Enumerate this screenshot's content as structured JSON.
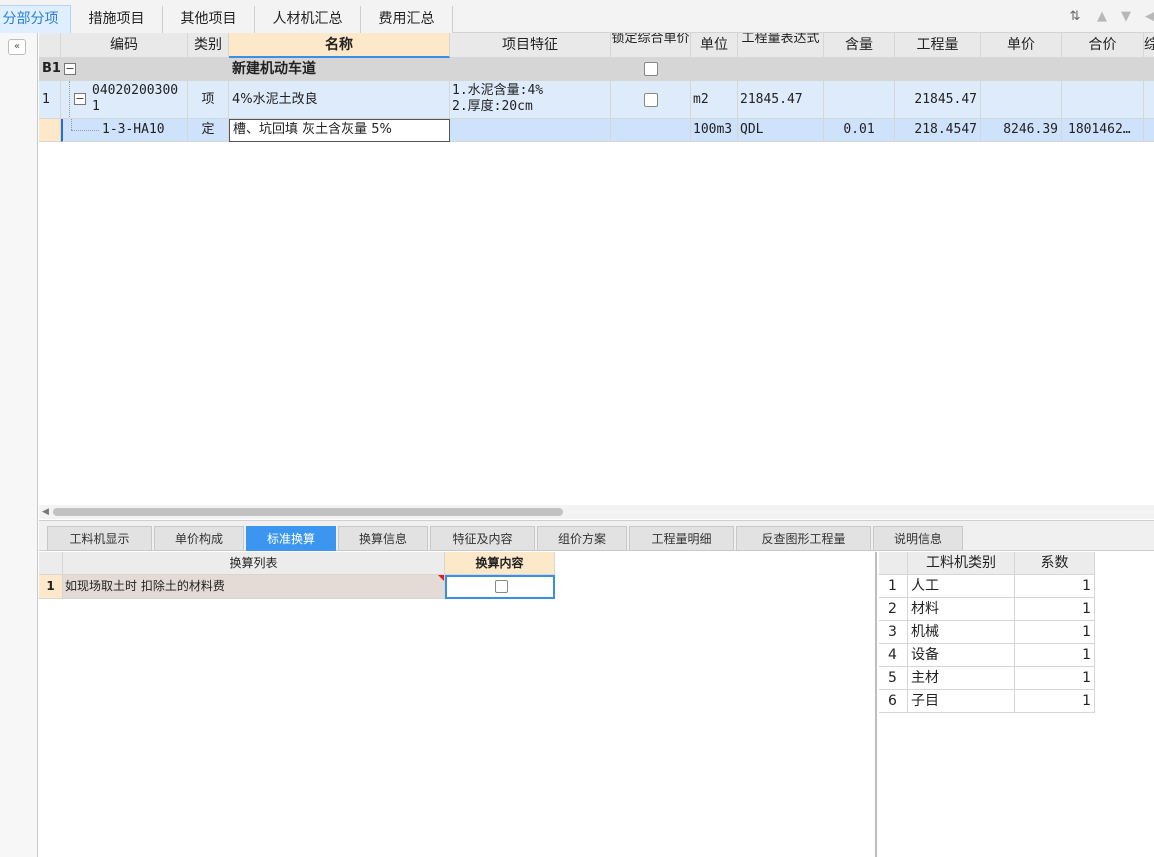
{
  "top_tabs": [
    "分部分项",
    "措施项目",
    "其他项目",
    "人材机汇总",
    "费用汇总"
  ],
  "active_top_tab": "分部分项",
  "columns": [
    "编码",
    "类别",
    "名称",
    "项目特征",
    "锁定综合单价",
    "单位",
    "工程量表达式",
    "含量",
    "工程量",
    "单价",
    "合价",
    "综"
  ],
  "rows": {
    "b1": {
      "num": "B1",
      "name": "新建机动车道"
    },
    "r1": {
      "num": "1",
      "code_line1": "04020200300",
      "code_line2": "1",
      "type": "项",
      "name": "4%水泥土改良",
      "feature_line1": "1.水泥含量:4%",
      "feature_line2": "2.厚度:20cm",
      "unit": "m2",
      "expr": "21845.47",
      "qty": "21845.47"
    },
    "r2": {
      "code": "1-3-HA10",
      "type": "定",
      "name": "槽、坑回填 灰土含灰量 5%",
      "unit": "100m3",
      "expr": "QDL",
      "content": "0.01",
      "qty": "218.4547",
      "price": "8246.39",
      "total": "1801462…"
    }
  },
  "bottom_tabs": [
    "工料机显示",
    "单价构成",
    "标准换算",
    "换算信息",
    "特征及内容",
    "组价方案",
    "工程量明细",
    "反查图形工程量",
    "说明信息"
  ],
  "active_bottom_tab": "标准换算",
  "conversion": {
    "headers": [
      "换算列表",
      "换算内容"
    ],
    "rows": [
      {
        "num": "1",
        "text": "如现场取土时 扣除土的材料费"
      }
    ]
  },
  "factors": {
    "headers": [
      "工料机类别",
      "系数"
    ],
    "rows": [
      {
        "num": "1",
        "name": "人工",
        "value": "1"
      },
      {
        "num": "2",
        "name": "材料",
        "value": "1"
      },
      {
        "num": "3",
        "name": "机械",
        "value": "1"
      },
      {
        "num": "4",
        "name": "设备",
        "value": "1"
      },
      {
        "num": "5",
        "name": "主材",
        "value": "1"
      },
      {
        "num": "6",
        "name": "子目",
        "value": "1"
      }
    ]
  },
  "colors": {
    "accent": "#3c96ef",
    "selected_header": "#fde8c9",
    "row_selected": "#cfe2fb"
  }
}
